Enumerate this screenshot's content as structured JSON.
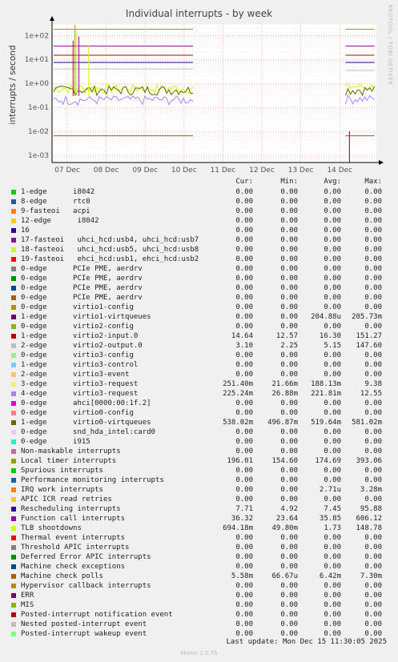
{
  "chart_data": {
    "type": "line",
    "title": "Individual interrupts - by week",
    "ylabel": "interrupts / second",
    "yscale": "log",
    "ylim": [
      0.0005,
      300
    ],
    "y_ticks": [
      "1e-03",
      "1e-02",
      "1e-01",
      "1e+00",
      "1e+01",
      "1e+02"
    ],
    "x_ticks": [
      "07 Dec",
      "08 Dec",
      "09 Dec",
      "10 Dec",
      "11 Dec",
      "12 Dec",
      "13 Dec",
      "14 Dec"
    ],
    "watermark": "RRDTOOL / TOBI OETIKER",
    "columns": [
      "Cur:",
      "Min:",
      "Avg:",
      "Max:"
    ],
    "series": [
      {
        "name": "1-edge      i8042",
        "color": "#00cc00",
        "cur": "0.00",
        "min": "0.00",
        "avg": "0.00",
        "max": "0.00"
      },
      {
        "name": "8-edge      rtc0",
        "color": "#0066b3",
        "cur": "0.00",
        "min": "0.00",
        "avg": "0.00",
        "max": "0.00"
      },
      {
        "name": "9-fasteoi   acpi",
        "color": "#ff8000",
        "cur": "0.00",
        "min": "0.00",
        "avg": "0.00",
        "max": "0.00"
      },
      {
        "name": "12-edge      i8042",
        "color": "#ffcc00",
        "cur": "0.00",
        "min": "0.00",
        "avg": "0.00",
        "max": "0.00"
      },
      {
        "name": "16",
        "color": "#330099",
        "cur": "0.00",
        "min": "0.00",
        "avg": "0.00",
        "max": "0.00"
      },
      {
        "name": "17-fasteoi   uhci_hcd:usb4, uhci_hcd:usb7",
        "color": "#990099",
        "cur": "0.00",
        "min": "0.00",
        "avg": "0.00",
        "max": "0.00"
      },
      {
        "name": "18-fasteoi   uhci_hcd:usb5, uhci_hcd:usb8",
        "color": "#ccff00",
        "cur": "0.00",
        "min": "0.00",
        "avg": "0.00",
        "max": "0.00"
      },
      {
        "name": "19-fasteoi   ehci_hcd:usb1, ehci_hcd:usb2",
        "color": "#ff0000",
        "cur": "0.00",
        "min": "0.00",
        "avg": "0.00",
        "max": "0.00"
      },
      {
        "name": "0-edge      PCIe PME, aerdrv",
        "color": "#808080",
        "cur": "0.00",
        "min": "0.00",
        "avg": "0.00",
        "max": "0.00"
      },
      {
        "name": "0-edge      PCIe PME, aerdrv",
        "color": "#008f00",
        "cur": "0.00",
        "min": "0.00",
        "avg": "0.00",
        "max": "0.00"
      },
      {
        "name": "0-edge      PCIe PME, aerdrv",
        "color": "#00487d",
        "cur": "0.00",
        "min": "0.00",
        "avg": "0.00",
        "max": "0.00"
      },
      {
        "name": "0-edge      PCIe PME, aerdrv",
        "color": "#b35a00",
        "cur": "0.00",
        "min": "0.00",
        "avg": "0.00",
        "max": "0.00"
      },
      {
        "name": "0-edge      virtio1-config",
        "color": "#b38f00",
        "cur": "0.00",
        "min": "0.00",
        "avg": "0.00",
        "max": "0.00"
      },
      {
        "name": "1-edge      virtio1-virtqueues",
        "color": "#6b006b",
        "cur": "0.00",
        "min": "0.00",
        "avg": "204.88u",
        "max": "205.73m"
      },
      {
        "name": "0-edge      virtio2-config",
        "color": "#8fb300",
        "cur": "0.00",
        "min": "0.00",
        "avg": "0.00",
        "max": "0.00"
      },
      {
        "name": "1-edge      virtio2-input.0",
        "color": "#b30000",
        "cur": "14.64",
        "min": "12.57",
        "avg": "16.30",
        "max": "151.27"
      },
      {
        "name": "2-edge      virtio2-output.0",
        "color": "#bebebe",
        "cur": "3.10",
        "min": "2.25",
        "avg": "5.15",
        "max": "147.60"
      },
      {
        "name": "0-edge      virtio3-config",
        "color": "#80ff80",
        "cur": "0.00",
        "min": "0.00",
        "avg": "0.00",
        "max": "0.00"
      },
      {
        "name": "1-edge      virtio3-control",
        "color": "#80c9ff",
        "cur": "0.00",
        "min": "0.00",
        "avg": "0.00",
        "max": "0.00"
      },
      {
        "name": "2-edge      virtio3-event",
        "color": "#ffc080",
        "cur": "0.00",
        "min": "0.00",
        "avg": "0.00",
        "max": "0.00"
      },
      {
        "name": "3-edge      virtio3-request",
        "color": "#ffe680",
        "cur": "251.40m",
        "min": "21.66m",
        "avg": "188.13m",
        "max": "9.38"
      },
      {
        "name": "4-edge      virtio3-request",
        "color": "#aa80ff",
        "cur": "225.24m",
        "min": "26.88m",
        "avg": "221.81m",
        "max": "12.55"
      },
      {
        "name": "0-edge      ahci[0000:00:1f.2]",
        "color": "#ee00cc",
        "cur": "0.00",
        "min": "0.00",
        "avg": "0.00",
        "max": "0.00"
      },
      {
        "name": "0-edge      virtio0-config",
        "color": "#ff8080",
        "cur": "0.00",
        "min": "0.00",
        "avg": "0.00",
        "max": "0.00"
      },
      {
        "name": "1-edge      virtio0-virtqueues",
        "color": "#666600",
        "cur": "538.02m",
        "min": "496.87m",
        "avg": "519.64m",
        "max": "581.02m"
      },
      {
        "name": "0-edge      snd_hda_intel:card0",
        "color": "#ffbfff",
        "cur": "0.00",
        "min": "0.00",
        "avg": "0.00",
        "max": "0.00"
      },
      {
        "name": "0-edge      i915",
        "color": "#00ffcc",
        "cur": "0.00",
        "min": "0.00",
        "avg": "0.00",
        "max": "0.00"
      },
      {
        "name": "Non-maskable interrupts",
        "color": "#cc6699",
        "cur": "0.00",
        "min": "0.00",
        "avg": "0.00",
        "max": "0.00"
      },
      {
        "name": "Local timer interrupts",
        "color": "#999900",
        "cur": "196.01",
        "min": "154.60",
        "avg": "174.69",
        "max": "393.06"
      },
      {
        "name": "Spurious interrupts",
        "color": "#00cc00",
        "cur": "0.00",
        "min": "0.00",
        "avg": "0.00",
        "max": "0.00"
      },
      {
        "name": "Performance monitoring interrupts",
        "color": "#0066b3",
        "cur": "0.00",
        "min": "0.00",
        "avg": "0.00",
        "max": "0.00"
      },
      {
        "name": "IRQ work interrupts",
        "color": "#ff8000",
        "cur": "0.00",
        "min": "0.00",
        "avg": "2.71u",
        "max": "3.28m"
      },
      {
        "name": "APIC ICR read retries",
        "color": "#ffcc00",
        "cur": "0.00",
        "min": "0.00",
        "avg": "0.00",
        "max": "0.00"
      },
      {
        "name": "Rescheduling interrupts",
        "color": "#330099",
        "cur": "7.71",
        "min": "4.92",
        "avg": "7.45",
        "max": "95.88"
      },
      {
        "name": "Function call interrupts",
        "color": "#990099",
        "cur": "36.32",
        "min": "23.64",
        "avg": "35.85",
        "max": "606.12"
      },
      {
        "name": "TLB shootdowns",
        "color": "#ccff00",
        "cur": "694.18m",
        "min": "49.80m",
        "avg": "1.73",
        "max": "148.78"
      },
      {
        "name": "Thermal event interrupts",
        "color": "#ff0000",
        "cur": "0.00",
        "min": "0.00",
        "avg": "0.00",
        "max": "0.00"
      },
      {
        "name": "Threshold APIC interrupts",
        "color": "#808080",
        "cur": "0.00",
        "min": "0.00",
        "avg": "0.00",
        "max": "0.00"
      },
      {
        "name": "Deferred Error APIC interrupts",
        "color": "#008f00",
        "cur": "0.00",
        "min": "0.00",
        "avg": "0.00",
        "max": "0.00"
      },
      {
        "name": "Machine check exceptions",
        "color": "#00487d",
        "cur": "0.00",
        "min": "0.00",
        "avg": "0.00",
        "max": "0.00"
      },
      {
        "name": "Machine check polls",
        "color": "#b35a00",
        "cur": "5.58m",
        "min": "66.67u",
        "avg": "6.42m",
        "max": "7.30m"
      },
      {
        "name": "Hypervisor callback interrupts",
        "color": "#b38f00",
        "cur": "0.00",
        "min": "0.00",
        "avg": "0.00",
        "max": "0.00"
      },
      {
        "name": "ERR",
        "color": "#6b006b",
        "cur": "0.00",
        "min": "0.00",
        "avg": "0.00",
        "max": "0.00"
      },
      {
        "name": "MIS",
        "color": "#8fb300",
        "cur": "0.00",
        "min": "0.00",
        "avg": "0.00",
        "max": "0.00"
      },
      {
        "name": "Posted-interrupt notification event",
        "color": "#b30000",
        "cur": "0.00",
        "min": "0.00",
        "avg": "0.00",
        "max": "0.00"
      },
      {
        "name": "Nested posted-interrupt event",
        "color": "#bebebe",
        "cur": "0.00",
        "min": "0.00",
        "avg": "0.00",
        "max": "0.00"
      },
      {
        "name": "Posted-interrupt wakeup event",
        "color": "#80ff80",
        "cur": "0.00",
        "min": "0.00",
        "avg": "0.00",
        "max": "0.00"
      }
    ],
    "lines": [
      {
        "label": "Local timer interrupts",
        "color": "#999900",
        "segments": [
          [
            0,
            3.25,
            180
          ],
          [
            7.5,
            7.9,
            180
          ]
        ]
      },
      {
        "label": "Function call interrupts",
        "color": "#990099",
        "segments": [
          [
            0,
            3.25,
            36
          ],
          [
            7.5,
            7.9,
            36
          ]
        ]
      },
      {
        "label": "virtio2-input.0",
        "color": "#b30000",
        "segments": [
          [
            0,
            3.25,
            15
          ],
          [
            7.5,
            7.9,
            15
          ]
        ]
      },
      {
        "label": "Rescheduling interrupts",
        "color": "#330099",
        "segments": [
          [
            0,
            3.25,
            7.5
          ],
          [
            7.5,
            7.9,
            7.5
          ]
        ]
      },
      {
        "label": "virtio2-output.0",
        "color": "#bebebe",
        "segments": [
          [
            0,
            3.25,
            4
          ],
          [
            7.5,
            7.9,
            3.5
          ]
        ]
      },
      {
        "label": "TLB shootdowns",
        "color": "#ccff00",
        "segments": [
          [
            0,
            3.25,
            0.6
          ],
          [
            7.5,
            7.9,
            0.7
          ]
        ]
      },
      {
        "label": "virtio0-virtqueues",
        "color": "#666600",
        "segments": [
          [
            0,
            3.25,
            0.52
          ],
          [
            7.5,
            7.9,
            0.52
          ]
        ]
      },
      {
        "label": "virtio3-request",
        "color": "#aa80ff",
        "segments": [
          [
            0,
            3.25,
            0.2
          ],
          [
            7.5,
            7.9,
            0.22
          ]
        ]
      },
      {
        "label": "Machine check polls",
        "color": "#b35a00",
        "segments": [
          [
            0,
            3.25,
            0.0065
          ],
          [
            7.5,
            7.9,
            0.0065
          ]
        ]
      }
    ],
    "last_update": "Last update: Mon Dec 15 11:30:05 2025",
    "footer": "Munin 2.0.75"
  }
}
